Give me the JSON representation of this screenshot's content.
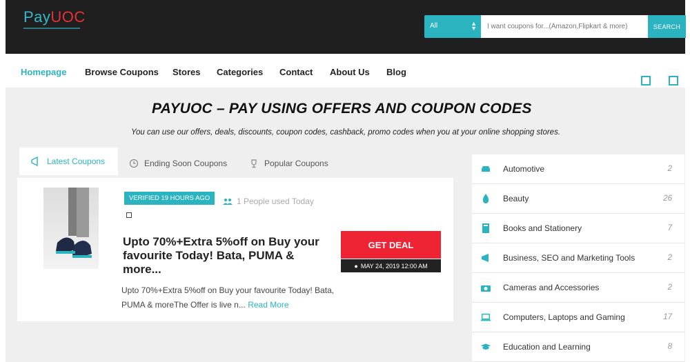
{
  "brand": {
    "name_prefix": "Pay",
    "name_highlight": "UOC"
  },
  "search": {
    "select_value": "All",
    "placeholder": "I want coupons for...(Amazon,Flipkart & more)",
    "button_label": "SEARCH"
  },
  "nav": {
    "items": [
      {
        "label": "Homepage",
        "active": true
      },
      {
        "label": "Browse Coupons"
      },
      {
        "label": "Stores"
      },
      {
        "label": "Categories"
      },
      {
        "label": "Contact"
      },
      {
        "label": "About Us"
      },
      {
        "label": "Blog"
      }
    ]
  },
  "hero": {
    "title": "PAYUOC – PAY USING OFFERS AND COUPON CODES",
    "subtitle": "You can use our offers, deals, discounts, coupon codes, cashback, promo codes when you at your online shopping stores."
  },
  "tabs": [
    {
      "label": "Latest Coupons",
      "icon": "megaphone-icon"
    },
    {
      "label": "Ending Soon Coupons",
      "icon": "clock-icon"
    },
    {
      "label": "Popular Coupons",
      "icon": "trophy-icon"
    }
  ],
  "coupon": {
    "badge": "VERIFIED 19 HOURS AGO",
    "people_used": "1 People used Today",
    "title": "Upto 70%+Extra 5%off on Buy your favourite Today! Bata, PUMA & more...",
    "description": "Upto 70%+Extra 5%off on Buy your favourite Today! Bata, PUMA & moreThe Offer is live n...",
    "read_more": "Read More",
    "deal_button": "GET DEAL",
    "date": "MAY 24, 2019 12:00 AM"
  },
  "categories": [
    {
      "label": "Automotive",
      "count": "2",
      "icon": "car-icon"
    },
    {
      "label": "Beauty",
      "count": "26",
      "icon": "drop-icon"
    },
    {
      "label": "Books and Stationery",
      "count": "7",
      "icon": "book-icon"
    },
    {
      "label": "Business, SEO and Marketing Tools",
      "count": "2",
      "icon": "megaphone-icon"
    },
    {
      "label": "Cameras and Accessories",
      "count": "2",
      "icon": "camera-icon"
    },
    {
      "label": "Computers, Laptops and Gaming",
      "count": "17",
      "icon": "laptop-icon"
    },
    {
      "label": "Education and Learning",
      "count": "8",
      "icon": "graduation-cap-icon"
    }
  ],
  "colors": {
    "accent": "#2bb3bf",
    "deal": "#ee2434",
    "topbar": "#1f1f1f"
  }
}
